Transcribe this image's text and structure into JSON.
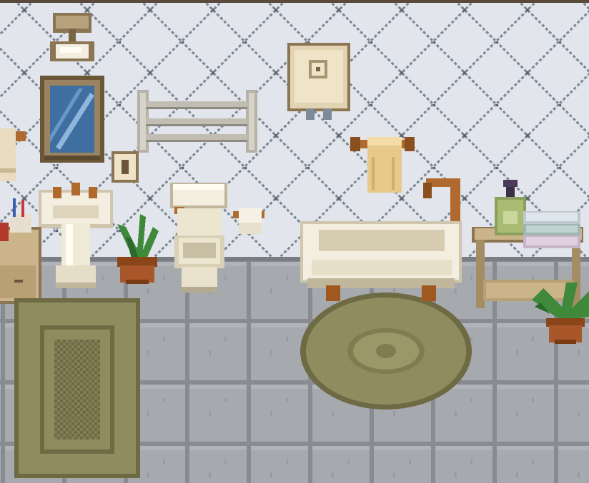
{
  "scene": {
    "type": "pixel-art bathroom interior",
    "palette": {
      "wall_tile": "#e2e6ec",
      "wall_grout": "#7e8a96",
      "floor_tile": "#a6a9ad",
      "floor_grout": "#888b90",
      "wood": "#b8a27c",
      "wood_dark": "#8b7553",
      "porcelain": "#f3eee0",
      "porcelain_shadow": "#cfc6ad",
      "copper": "#b0692e",
      "rug_olive": "#8f8c5f",
      "rug_olive_dark": "#6e6a44",
      "plant_green": "#3f8a3a",
      "pot_terracotta": "#9b4f23"
    },
    "objects": [
      {
        "name": "ceiling-light",
        "icon": "ceiling-lamp-icon"
      },
      {
        "name": "wall-mirror",
        "icon": "mirror-icon"
      },
      {
        "name": "towel-rack-empty",
        "icon": "towel-rack-icon"
      },
      {
        "name": "wall-cabinet",
        "icon": "cabinet-icon"
      },
      {
        "name": "light-switch",
        "icon": "switch-icon"
      },
      {
        "name": "towel-on-rod",
        "icon": "towel-icon"
      },
      {
        "name": "pedestal-sink",
        "icon": "sink-icon"
      },
      {
        "name": "potted-plant-small",
        "icon": "plant-icon"
      },
      {
        "name": "toilet",
        "icon": "toilet-icon"
      },
      {
        "name": "toilet-paper",
        "icon": "toilet-paper-icon"
      },
      {
        "name": "clawfoot-bathtub",
        "icon": "bathtub-icon"
      },
      {
        "name": "side-table",
        "icon": "table-icon"
      },
      {
        "name": "soap-dispenser",
        "icon": "soap-icon"
      },
      {
        "name": "folded-towels",
        "icon": "towels-icon"
      },
      {
        "name": "potted-plant-right",
        "icon": "plant-icon"
      },
      {
        "name": "rectangular-rug",
        "icon": "rug-icon"
      },
      {
        "name": "oval-rug",
        "icon": "rug-icon"
      }
    ]
  }
}
